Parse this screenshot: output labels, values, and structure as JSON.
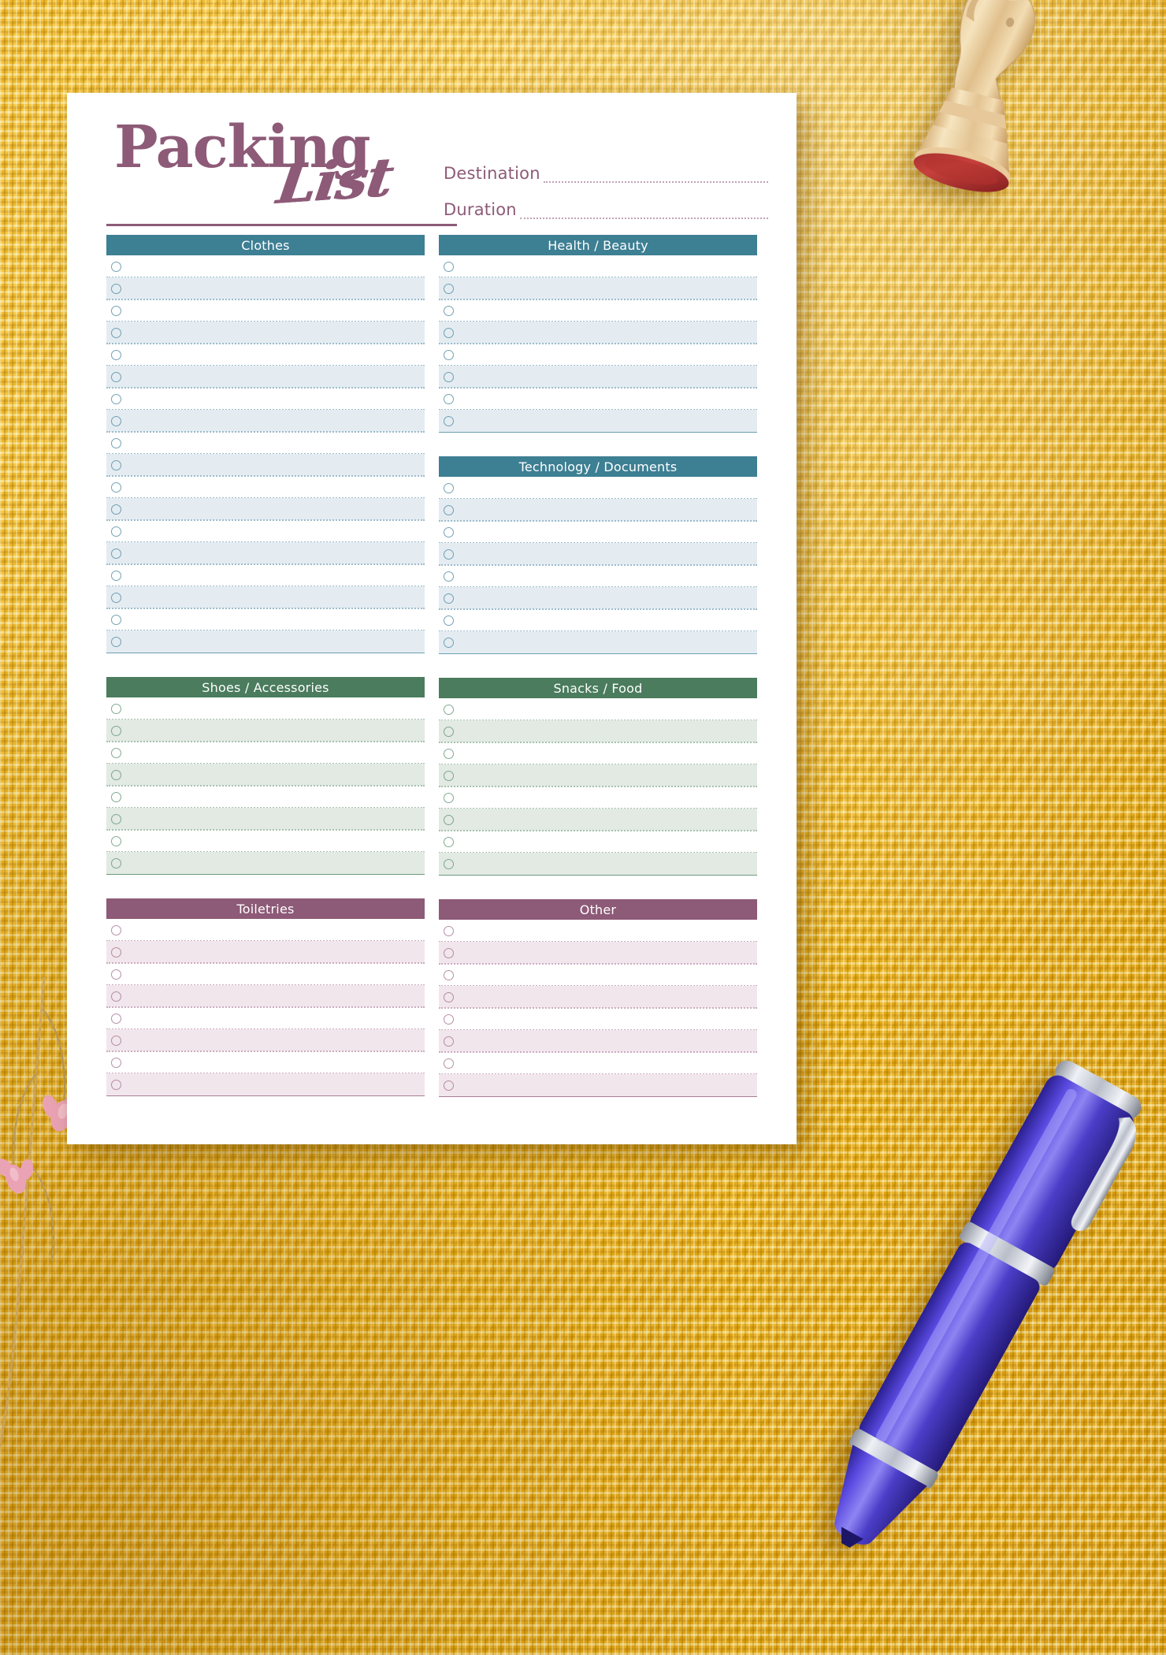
{
  "document": {
    "title_main": "Packing",
    "title_script": "List",
    "accent_mauve": "#8d5a77",
    "accent_teal": "#3d7f93",
    "accent_green": "#4a7c5d"
  },
  "fields": [
    {
      "label": "Destination",
      "value": ""
    },
    {
      "label": "Duration",
      "value": ""
    }
  ],
  "sections": {
    "clothes": {
      "title": "Clothes",
      "theme": "teal",
      "rows": 18
    },
    "shoes": {
      "title": "Shoes / Accessories",
      "theme": "green",
      "rows": 8
    },
    "toiletries": {
      "title": "Toiletries",
      "theme": "mauve",
      "rows": 8
    },
    "health": {
      "title": "Health / Beauty",
      "theme": "teal",
      "rows": 8
    },
    "technology": {
      "title": "Technology / Documents",
      "theme": "teal",
      "rows": 8
    },
    "snacks": {
      "title": "Snacks / Food",
      "theme": "green",
      "rows": 8
    },
    "other": {
      "title": "Other",
      "theme": "mauve",
      "rows": 8
    }
  },
  "column_order": {
    "left": [
      "clothes",
      "shoes",
      "toiletries"
    ],
    "right": [
      "health",
      "technology",
      "snacks",
      "other"
    ]
  },
  "props": [
    {
      "name": "chess-knight-piece",
      "material": "wood",
      "accent": "#b23a3a"
    },
    {
      "name": "fountain-pen",
      "body_color": "#4b3ec8",
      "trim_color": "#c9ccd6"
    },
    {
      "name": "dried-flower-sprig",
      "petal_color": "#e8a0ae"
    }
  ],
  "background": {
    "name": "yellow-woven-fabric",
    "color": "#eeb617"
  }
}
